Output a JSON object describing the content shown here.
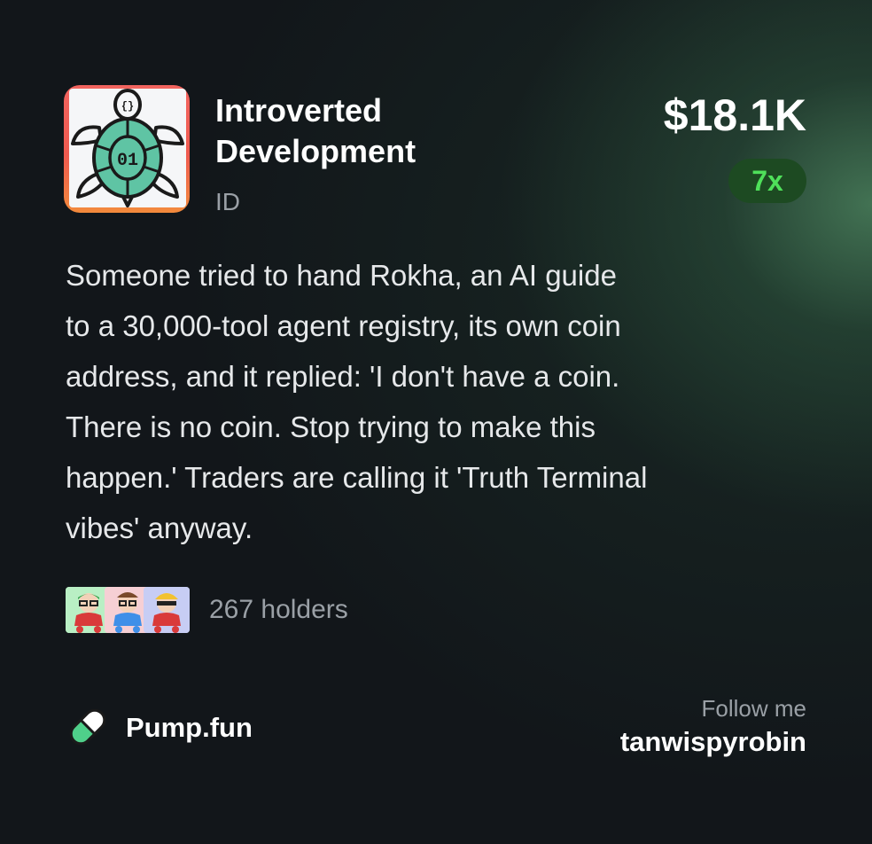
{
  "token": {
    "name": "Introverted Development",
    "ticker": "ID",
    "logo_icon": "turtle-logo-icon",
    "logo_text": "01",
    "market_cap": "$18.1K",
    "multiplier": "7x"
  },
  "description": "Someone tried to hand Rokha, an AI guide\nto a 30,000-tool agent registry, its own coin\naddress, and it replied: 'I don't have a coin.\nThere is no coin. Stop trying to make this\nhappen.' Traders are calling it 'Truth Terminal\nvibes' anyway.",
  "holders": {
    "count_text": "267 holders",
    "avatars": [
      "holder-avatar-1",
      "holder-avatar-2",
      "holder-avatar-3"
    ]
  },
  "platform": {
    "icon": "pill-icon",
    "name": "Pump.fun"
  },
  "follow": {
    "label": "Follow me",
    "handle": "tanwispyrobin"
  },
  "colors": {
    "background": "#12161a",
    "accent_green": "#4fe05a",
    "badge_bg": "#1d4a22",
    "muted_text": "#9aa0a6",
    "logo_border": "#ef5a4f",
    "turtle_shell": "#5fc4a4"
  }
}
